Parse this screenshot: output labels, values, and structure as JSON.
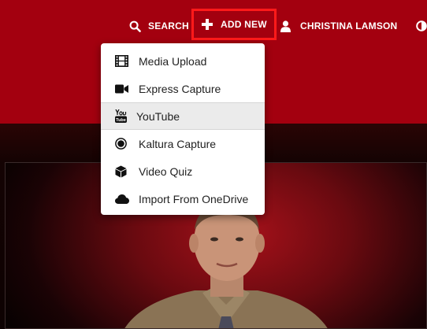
{
  "header": {
    "search_label": "SEARCH",
    "add_new_label": "ADD NEW",
    "user_label": "CHRISTINA LAMSON"
  },
  "colors": {
    "header_bg": "#a3000f",
    "highlight_border": "#ff1a1a",
    "menu_bg": "#ffffff",
    "menu_active_bg": "#ebebeb"
  },
  "add_new_menu": {
    "items": [
      {
        "label": "Media Upload",
        "icon": "film-icon"
      },
      {
        "label": "Express Capture",
        "icon": "video-camera-icon"
      },
      {
        "label": "YouTube",
        "icon": "youtube-icon"
      },
      {
        "label": "Kaltura Capture",
        "icon": "record-icon"
      },
      {
        "label": "Video Quiz",
        "icon": "cube-icon"
      },
      {
        "label": "Import From OneDrive",
        "icon": "cloud-icon"
      }
    ]
  }
}
